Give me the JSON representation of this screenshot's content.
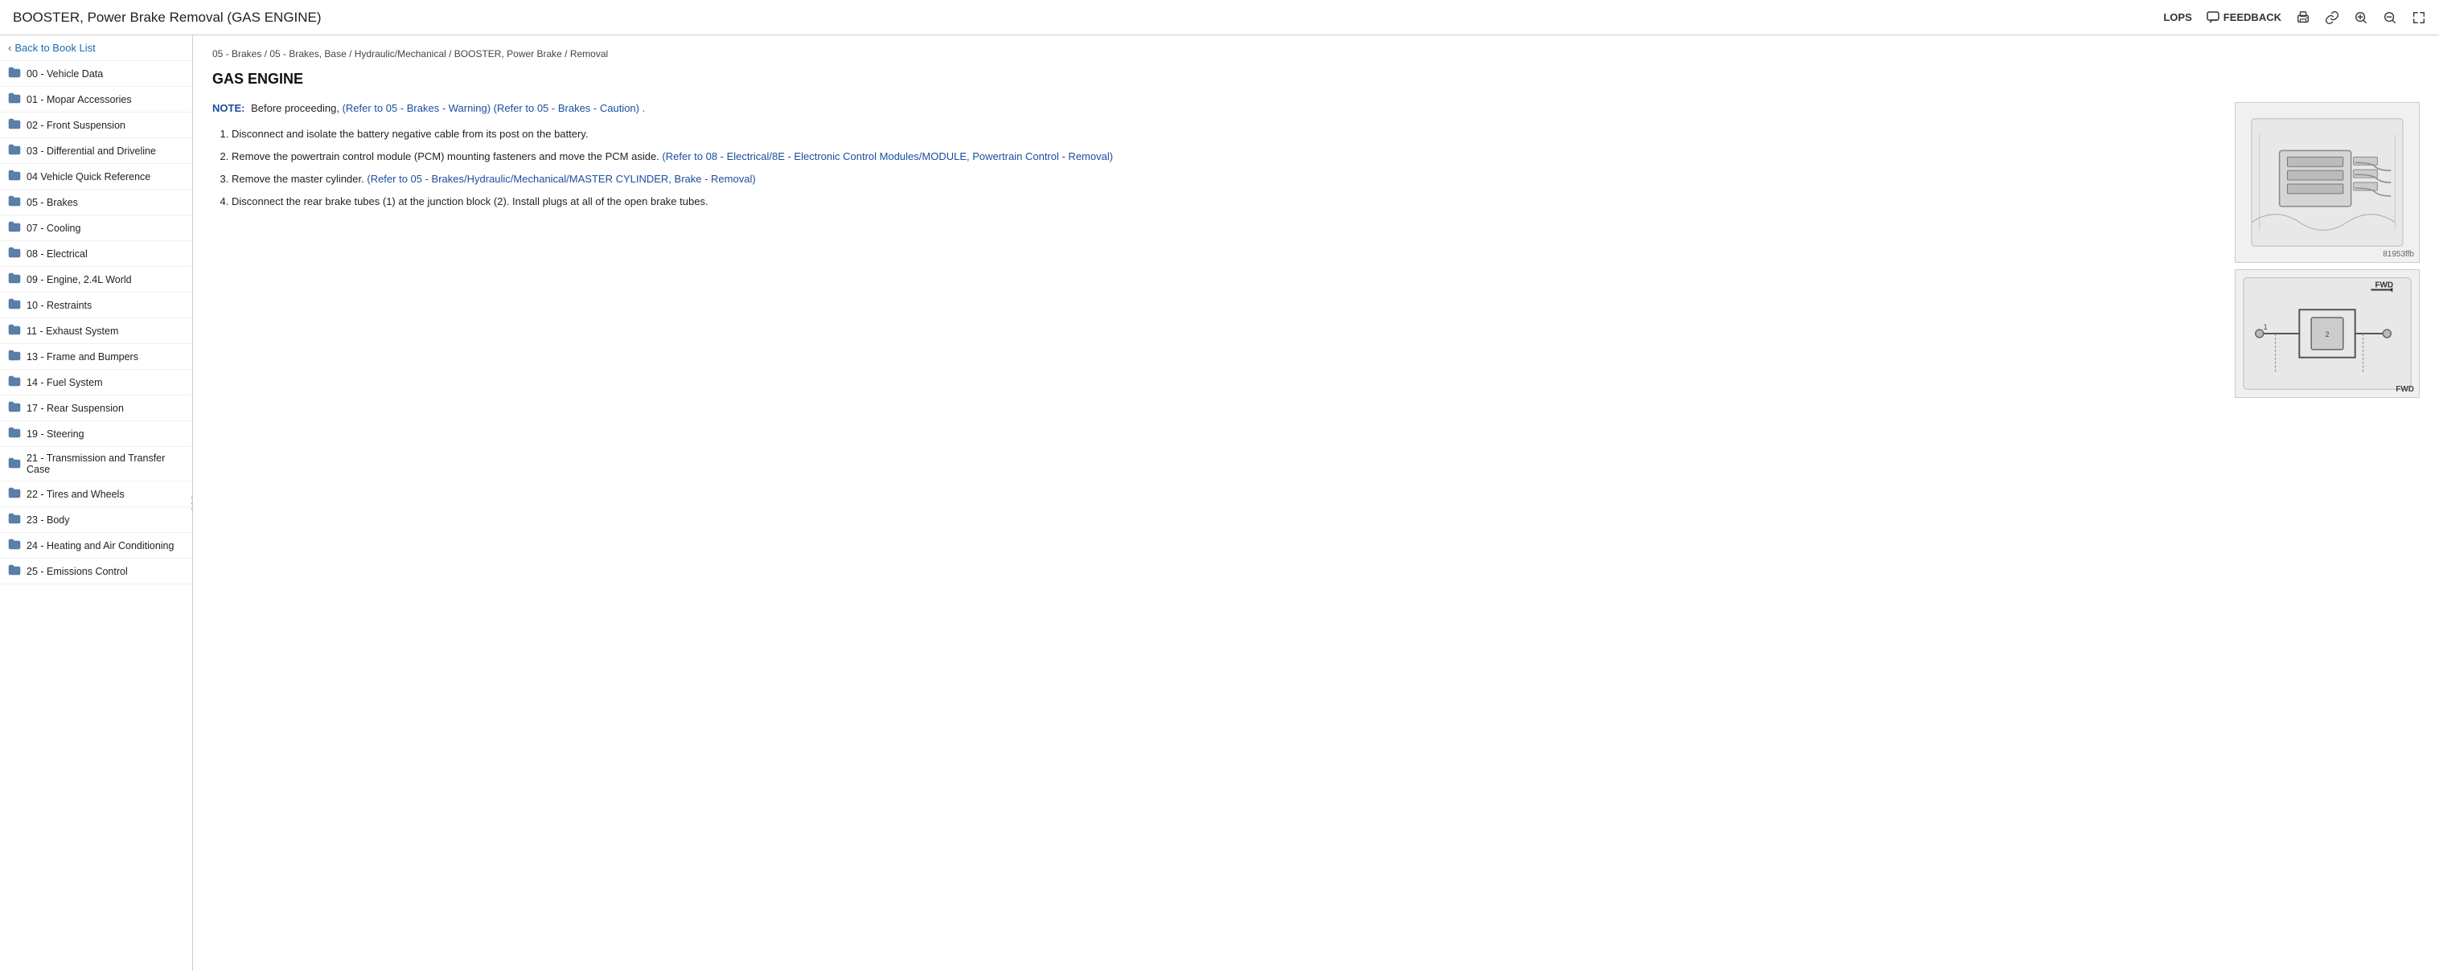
{
  "header": {
    "title": "BOOSTER, Power Brake Removal (GAS ENGINE)",
    "lops": "LOPS",
    "feedback": "FEEDBACK",
    "icons": {
      "print": "🖨",
      "link": "🔗",
      "zoom_in": "🔍",
      "zoom_out": "🔍"
    }
  },
  "sidebar": {
    "back_label": "Back to Book List",
    "items": [
      {
        "id": "00",
        "label": "00 - Vehicle Data"
      },
      {
        "id": "01",
        "label": "01 - Mopar Accessories"
      },
      {
        "id": "02",
        "label": "02 - Front Suspension"
      },
      {
        "id": "03",
        "label": "03 - Differential and Driveline"
      },
      {
        "id": "04",
        "label": "04 Vehicle Quick Reference"
      },
      {
        "id": "05",
        "label": "05 - Brakes"
      },
      {
        "id": "07",
        "label": "07 - Cooling"
      },
      {
        "id": "08",
        "label": "08 - Electrical"
      },
      {
        "id": "09",
        "label": "09 - Engine, 2.4L World"
      },
      {
        "id": "10",
        "label": "10 - Restraints"
      },
      {
        "id": "11",
        "label": "11 - Exhaust System"
      },
      {
        "id": "13",
        "label": "13 - Frame and Bumpers"
      },
      {
        "id": "14",
        "label": "14 - Fuel System"
      },
      {
        "id": "17",
        "label": "17 - Rear Suspension"
      },
      {
        "id": "19",
        "label": "19 - Steering"
      },
      {
        "id": "21",
        "label": "21 - Transmission and Transfer Case"
      },
      {
        "id": "22",
        "label": "22 - Tires and Wheels"
      },
      {
        "id": "23",
        "label": "23 - Body"
      },
      {
        "id": "24",
        "label": "24 - Heating and Air Conditioning"
      },
      {
        "id": "25",
        "label": "25 - Emissions Control"
      }
    ]
  },
  "content": {
    "breadcrumb": "05 - Brakes / 05 - Brakes, Base / Hydraulic/Mechanical / BOOSTER, Power Brake / Removal",
    "title": "GAS ENGINE",
    "note_label": "NOTE:",
    "note_prefix": "Before proceeding,",
    "note_link_text": "(Refer to 05 - Brakes - Warning) (Refer to 05 - Brakes - Caution) .",
    "steps": [
      {
        "text": "Disconnect and isolate the battery negative cable from its post on the battery.",
        "link": null,
        "link_text": null
      },
      {
        "text_before": "Remove the powertrain control module (PCM) mounting fasteners and move the PCM aside.",
        "link_text": "(Refer to 08 - Electrical/8E - Electronic Control Modules/MODULE, Powertrain Control - Removal)",
        "link": "#"
      },
      {
        "text_before": "Remove the master cylinder.",
        "link_text": "(Refer to 05 - Brakes/Hydraulic/Mechanical/MASTER CYLINDER, Brake - Removal)",
        "link": "#"
      },
      {
        "text": "Disconnect the rear brake tubes (1) at the junction block (2). Install plugs at all of the open brake tubes.",
        "link": null,
        "link_text": null
      }
    ],
    "diagram1_label": "81953ffb",
    "diagram2_label": "FWD"
  }
}
